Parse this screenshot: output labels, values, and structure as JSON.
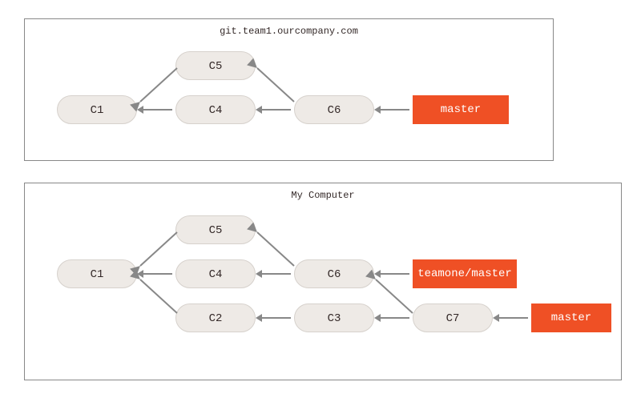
{
  "top": {
    "title": "git.team1.ourcompany.com",
    "commits": {
      "c1": "C1",
      "c4": "C4",
      "c5": "C5",
      "c6": "C6"
    },
    "refs": {
      "master": "master"
    }
  },
  "bottom": {
    "title": "My Computer",
    "commits": {
      "c1": "C1",
      "c2": "C2",
      "c3": "C3",
      "c4": "C4",
      "c5": "C5",
      "c6": "C6",
      "c7": "C7"
    },
    "refs": {
      "teamone": "teamone/master",
      "master": "master"
    }
  }
}
